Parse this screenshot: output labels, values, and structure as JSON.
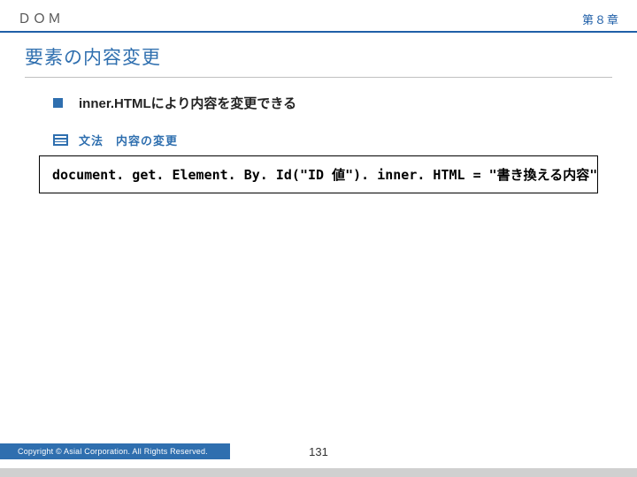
{
  "header": {
    "left": "ＤＯＭ",
    "right": "第８章"
  },
  "section_title": "要素の内容変更",
  "bullet": {
    "text": "inner.HTMLにより内容を変更できる"
  },
  "syntax": {
    "label": "文法　内容の変更"
  },
  "code": "document. get. Element. By. Id(\"ID 値\"). inner. HTML = \"書き換える内容\";",
  "footer": {
    "copyright": "Copyright ©  Asial Corporation. All Rights Reserved.",
    "page": "131"
  }
}
